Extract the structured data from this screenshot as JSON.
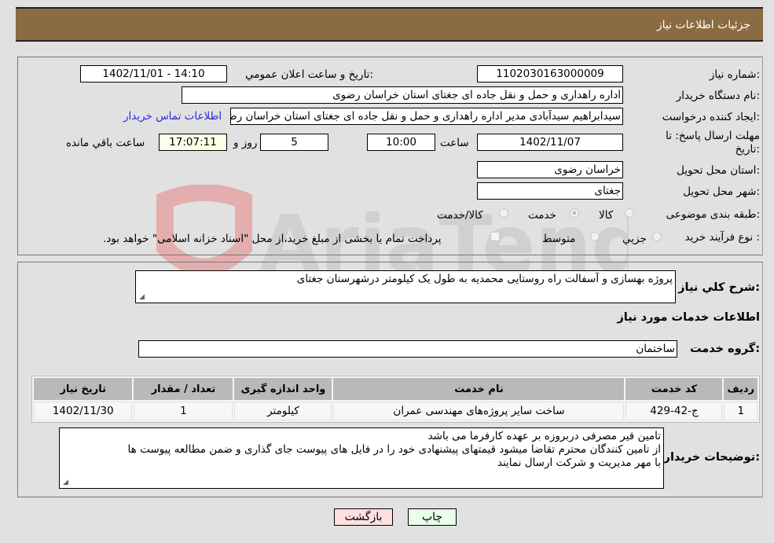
{
  "header": {
    "title": "جزئیات اطلاعات نیاز"
  },
  "form": {
    "need_number": {
      "label": "شماره نیاز:",
      "value": "1102030163000009"
    },
    "announce_datetime": {
      "label": "تاریخ و ساعت اعلان عمومي:",
      "value": "1402/11/01 - 14:10"
    },
    "buyer_org": {
      "label": "نام دستگاه خريدار:",
      "value": "اداره راهداری و حمل و نقل جاده ای جغتای استان خراسان رضوی"
    },
    "requester": {
      "label": "ایجاد کننده درخواست:",
      "value": "سیدابراهیم سیدآبادی مدیر اداره راهداری و حمل و نقل جاده ای جغتای استان خراسان رضوی"
    },
    "buyer_contact_link": "اطلاعات تماس خریدار",
    "deadline": {
      "label": "مهلت ارسال پاسخ: تا تاریخ:",
      "date": "1402/11/07",
      "time_label": "ساعت",
      "time": "10:00",
      "days": "5",
      "days_label": "روز و",
      "remaining": "17:07:11",
      "remaining_label": "ساعت باقي مانده"
    },
    "delivery_province": {
      "label": "استان محل تحویل:",
      "value": "خراسان رضوی"
    },
    "delivery_city": {
      "label": "شهر محل تحویل:",
      "value": "جغتای"
    },
    "category": {
      "label": "طبقه بندی موضوعی:",
      "options": [
        "کالا",
        "خدمت",
        "کالا/خدمت"
      ],
      "selected": "خدمت"
    },
    "purchase_type": {
      "label": "نوع فرآیند خرید :",
      "options": [
        "جزيي",
        "متوسط"
      ],
      "payment_note": "پرداخت تمام یا بخشی از مبلغ خرید،از محل \"اسناد خزانه اسلامی\" خواهد بود."
    }
  },
  "details": {
    "summary_label": "شرح کلي نياز:",
    "summary_value": "پروژه بهسازی و آسفالت راه روستایی محمدیه به طول یک کیلومتر درشهرستان جغتای",
    "services_heading": "اطلاعات خدمات مورد نیاز",
    "service_group_label": "گروه خدمت:",
    "service_group_value": "ساختمان",
    "table": {
      "headers": [
        "رديف",
        "کد خدمت",
        "نام خدمت",
        "واحد اندازه گیری",
        "تعداد / مقدار",
        "تاریخ نیاز"
      ],
      "rows": [
        [
          "1",
          "ج-42-429",
          "ساخت سایر پروژه‌های مهندسی عمران",
          "کیلومتر",
          "1",
          "1402/11/30"
        ]
      ]
    },
    "buyer_notes_label": "توضیحات خریدار:",
    "buyer_notes_lines": [
      "تامین قیر مصرفی دربروزه بر عهده کارفرما می باشد",
      "از تامین کنندگان محترم تقاضا میشود قیمتهای پیشنهادی خود را در فایل های پیوست جای گذاری و ضمن مطالعه پیوست ها",
      "با مهر مدیریت و شرکت ارسال نمایند"
    ]
  },
  "buttons": {
    "print": "چاپ",
    "back": "بازگشت"
  },
  "colors": {
    "header_bg": "#8b6b41",
    "link": "#2a2ae0",
    "back_bg": "#ffe0e0",
    "print_bg": "#e8ffe8"
  }
}
